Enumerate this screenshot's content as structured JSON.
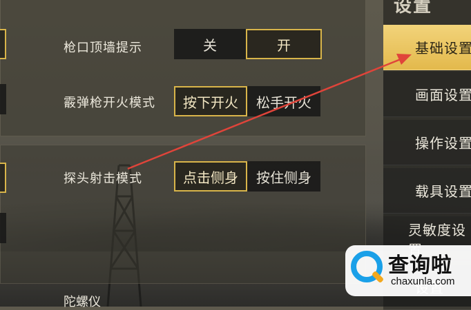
{
  "settings": {
    "muzzle_wall_hint": {
      "label": "枪口顶墙提示",
      "options": [
        "关",
        "开"
      ],
      "selected": "开"
    },
    "shotgun_fire_mode": {
      "label": "霰弹枪开火模式",
      "options": [
        "按下开火",
        "松手开火"
      ],
      "selected": "按下开火"
    },
    "peek_mode": {
      "label": "探头射击模式",
      "options": [
        "点击侧身",
        "按住侧身"
      ],
      "selected": "点击侧身"
    },
    "gyroscope": {
      "label": "陀螺仪"
    }
  },
  "sidebar": {
    "title": "设置",
    "items": [
      {
        "label": "基础设置",
        "active": true
      },
      {
        "label": "画面设置"
      },
      {
        "label": "操作设置"
      },
      {
        "label": "载具设置"
      },
      {
        "label": "灵敏度设置"
      },
      {
        "label": "设置"
      }
    ]
  },
  "annotation": {
    "color": "#e0443a",
    "type": "arrow"
  },
  "watermark": {
    "cn": "查询啦",
    "en": "chaxunla.com"
  },
  "colors": {
    "accent_gold": "#d9b54a",
    "active_tab": "#f2d37a"
  }
}
